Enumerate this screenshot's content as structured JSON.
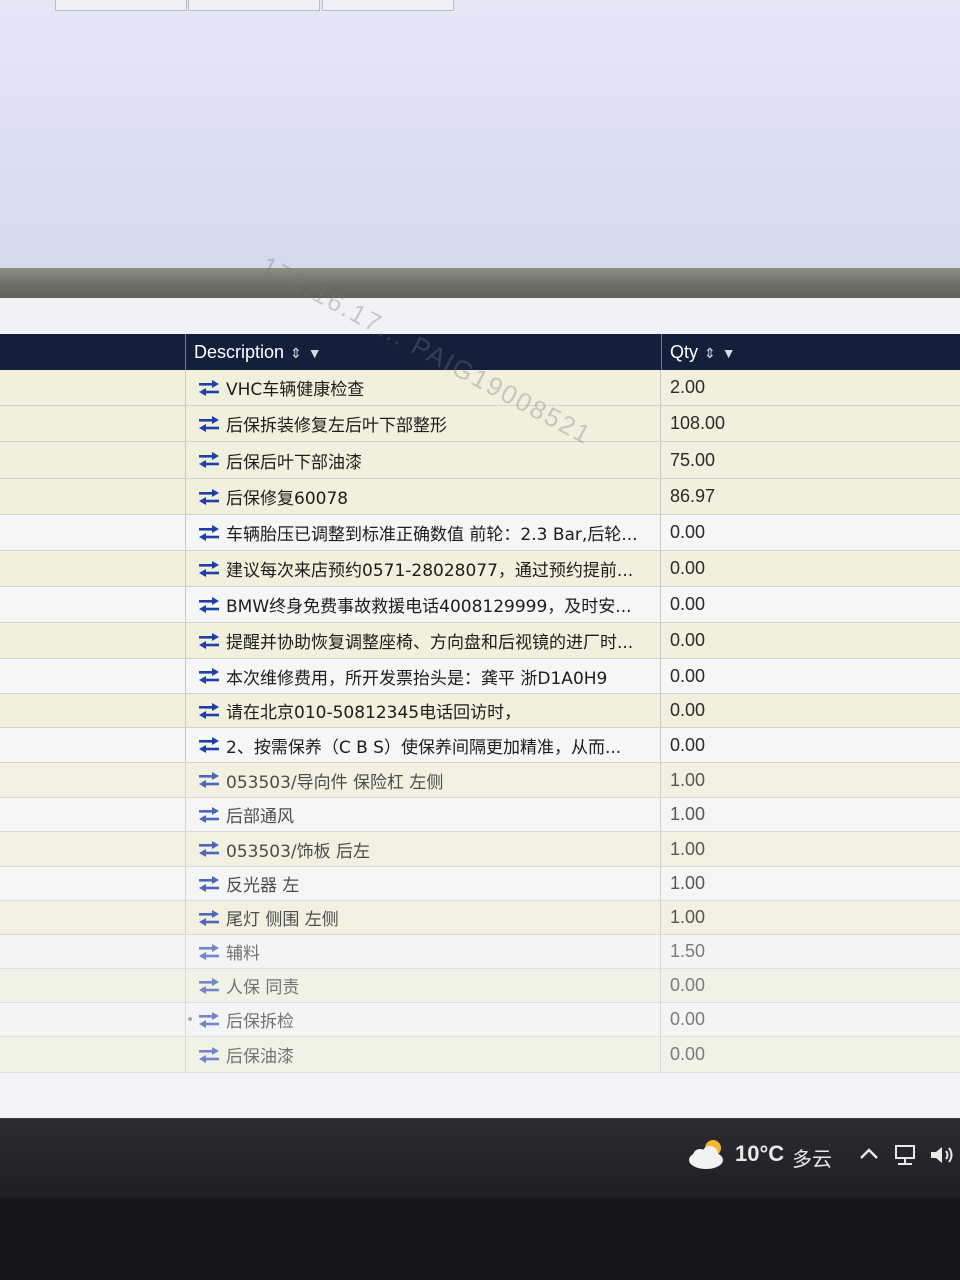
{
  "watermark": {
    "text": "172.16.17... PAIG19008521"
  },
  "grid": {
    "columns": [
      {
        "label": "Description",
        "sortable": true,
        "filterable": true
      },
      {
        "label": "Qty",
        "sortable": true,
        "filterable": true
      }
    ],
    "rows": [
      {
        "description": "VHC车辆健康检查",
        "qty": "2.00"
      },
      {
        "description": "后保拆装修复左后叶下部整形",
        "qty": "108.00"
      },
      {
        "description": "后保后叶下部油漆",
        "qty": "75.00"
      },
      {
        "description": "后保修复60078",
        "qty": "86.97"
      },
      {
        "description": "车辆胎压已调整到标准正确数值 前轮：2.3 Bar,后轮...",
        "qty": "0.00"
      },
      {
        "description": "建议每次来店预约0571-28028077，通过预约提前...",
        "qty": "0.00"
      },
      {
        "description": "BMW终身免费事故救援电话4008129999，及时安...",
        "qty": "0.00"
      },
      {
        "description": "提醒并协助恢复调整座椅、方向盘和后视镜的进厂时...",
        "qty": "0.00"
      },
      {
        "description": "本次维修费用，所开发票抬头是：龚平 浙D1A0H9",
        "qty": "0.00"
      },
      {
        "description": "请在北京010-50812345电话回访时，",
        "qty": "0.00"
      },
      {
        "description": "2、按需保养（C B S）使保养间隔更加精准，从而...",
        "qty": "0.00"
      },
      {
        "description": "053503/导向件 保险杠 左侧",
        "qty": "1.00"
      },
      {
        "description": "后部通风",
        "qty": "1.00"
      },
      {
        "description": "053503/饰板 后左",
        "qty": "1.00"
      },
      {
        "description": "反光器 左",
        "qty": "1.00"
      },
      {
        "description": "尾灯 侧围 左侧",
        "qty": "1.00"
      },
      {
        "description": "辅料",
        "qty": "1.50"
      },
      {
        "description": "人保 同责",
        "qty": "0.00"
      },
      {
        "description": "后保拆检",
        "qty": "0.00"
      },
      {
        "description": "后保油漆",
        "qty": "0.00"
      }
    ]
  },
  "taskbar": {
    "weather_icon": "cloudy-sun-icon",
    "temperature": "10°C",
    "condition": "多云",
    "tray_icons": [
      "chevron-up-icon",
      "network-icon",
      "volume-icon"
    ]
  },
  "colors": {
    "header_bg": "#13203b",
    "row_alt_bg": "#f1f0dc",
    "row_plain_bg": "#f6f6f6",
    "swap_icon": "#1f3fa8",
    "taskbar_bg": "#1d1f22"
  }
}
